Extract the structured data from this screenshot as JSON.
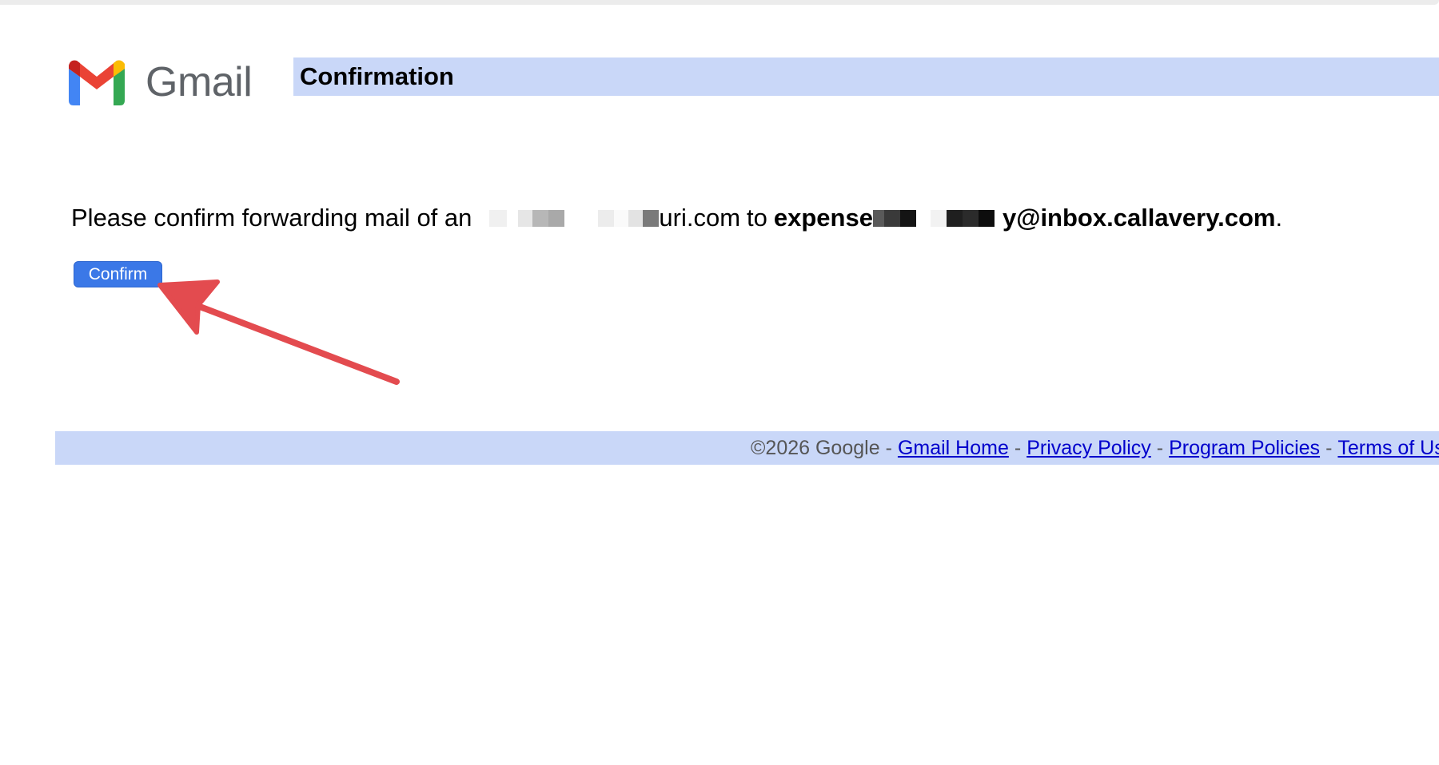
{
  "logo": {
    "wordmark": "Gmail",
    "icon": "gmail-m-icon"
  },
  "header": {
    "title": "Confirmation"
  },
  "message": {
    "prefix": "Please confirm forwarding mail of an",
    "source_suffix": "uri.com",
    "connector": "to",
    "target_prefix": "expense",
    "target_suffix": "y@inbox.callavery.com",
    "end": "."
  },
  "confirm_button": {
    "label": "Confirm"
  },
  "footer": {
    "copyright": "©2026 Google",
    "separator": "-",
    "links": [
      "Gmail Home",
      "Privacy Policy",
      "Program Policies",
      "Terms of Use"
    ]
  },
  "colors": {
    "header_bg": "#c9d7f8",
    "button_bg": "#3b78e7",
    "arrow": "#e34b4f",
    "link": "#0000cc"
  }
}
